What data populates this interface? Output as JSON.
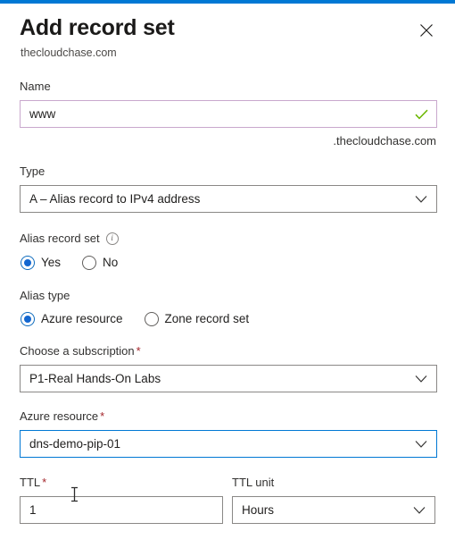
{
  "window": {
    "accent_color": "#0078d4",
    "title": "Add record set",
    "subtitle": "thecloudchase.com",
    "close_icon": "close-icon"
  },
  "form": {
    "name": {
      "label": "Name",
      "value": "www",
      "placeholder": "",
      "suffix": ".thecloudchase.com",
      "validation_icon": "checkmark-icon",
      "validation_color": "#6bb700",
      "border_color": "#c9a8cd"
    },
    "type": {
      "label": "Type",
      "value": "A – Alias record to IPv4 address",
      "chevron_icon": "chevron-down-icon"
    },
    "alias_record_set": {
      "label": "Alias record set",
      "info_icon": "info-icon",
      "info_glyph": "i",
      "options": [
        {
          "label": "Yes",
          "selected": true
        },
        {
          "label": "No",
          "selected": false
        }
      ]
    },
    "alias_type": {
      "label": "Alias type",
      "options": [
        {
          "label": "Azure resource",
          "selected": true
        },
        {
          "label": "Zone record set",
          "selected": false
        }
      ]
    },
    "subscription": {
      "label": "Choose a subscription",
      "required_marker": "*",
      "value": "P1-Real Hands-On Labs",
      "chevron_icon": "chevron-down-icon"
    },
    "azure_resource": {
      "label": "Azure resource",
      "required_marker": "*",
      "value": "dns-demo-pip-01",
      "chevron_icon": "chevron-down-icon",
      "focused": true,
      "focus_color": "#0078d4"
    },
    "ttl": {
      "label": "TTL",
      "required_marker": "*",
      "value": "1",
      "placeholder": ""
    },
    "ttl_unit": {
      "label": "TTL unit",
      "value": "Hours",
      "chevron_icon": "chevron-down-icon"
    }
  },
  "cursor": {
    "type": "text-ibeam-cursor"
  }
}
